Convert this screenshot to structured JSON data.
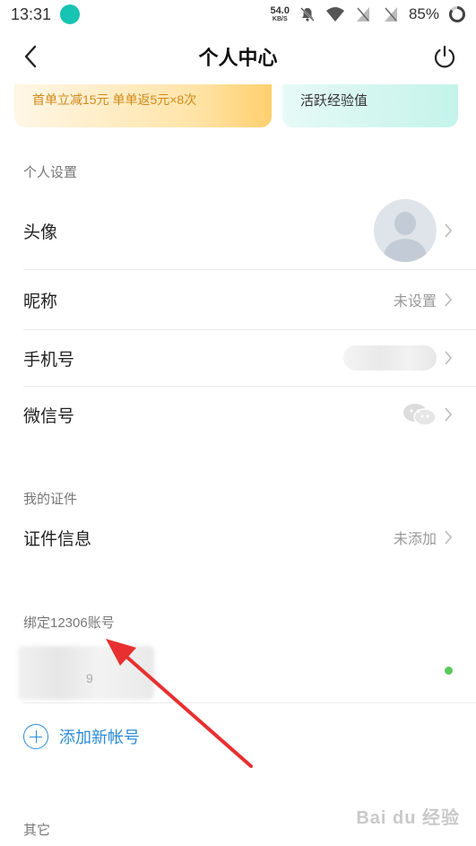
{
  "status_bar": {
    "time": "13:31",
    "net_speed_value": "54.0",
    "net_speed_unit": "KB/S",
    "battery": "85%",
    "icons": [
      "app-notification-icon",
      "mute-bell-icon",
      "wifi-icon",
      "no-sim-icon",
      "no-sim-icon",
      "battery-ring-icon"
    ]
  },
  "nav": {
    "title": "个人中心",
    "back_icon": "chevron-left-icon",
    "power_icon": "power-icon"
  },
  "promo": {
    "left_text": "首单立减15元 单单返5元×8次",
    "right_text": "活跃经验值"
  },
  "personal_settings": {
    "section_title": "个人设置",
    "avatar_label": "头像",
    "nickname_label": "昵称",
    "nickname_value": "未设置",
    "phone_label": "手机号",
    "wechat_label": "微信号"
  },
  "documents": {
    "section_title": "我的证件",
    "id_info_label": "证件信息",
    "id_info_value": "未添加"
  },
  "bind_12306": {
    "section_title": "绑定12306账号",
    "account_suffix": "9",
    "status_color": "#5ac85a",
    "add_label": "添加新帐号"
  },
  "other": {
    "section_title": "其它"
  },
  "colors": {
    "accent_blue": "#2b8bd8",
    "annotation_red": "#e83030"
  }
}
